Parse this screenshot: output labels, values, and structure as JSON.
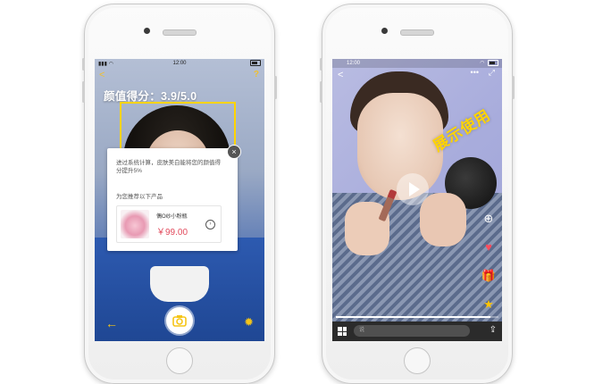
{
  "left_phone": {
    "status_time": "12:00",
    "score_text": "颜值得分：3.9/5.0",
    "popup": {
      "message": "进过系统计算，皮肤美白能将您的颜值得分提升5%",
      "recommend_label": "为您推荐以下产品",
      "product_name": "偶O纱小粉瓶",
      "product_price": "￥99.00"
    },
    "icons": [
      "back-arrow-icon",
      "help-icon",
      "close-icon",
      "camera-icon",
      "gear-icon",
      "chevron-right-icon"
    ],
    "accent": "#f5c518",
    "price_color": "#e24b5d"
  },
  "right_phone": {
    "status_time": "12:00",
    "watermark": "展示使用",
    "comment_placeholder": "说",
    "video_progress": 0.95,
    "icons": [
      "back-icon",
      "more-icon",
      "fullscreen-icon",
      "play-icon",
      "add-icon",
      "heart-icon",
      "gift-icon",
      "star-icon",
      "grid-icon",
      "share-icon"
    ],
    "accent": "#ffd400"
  }
}
